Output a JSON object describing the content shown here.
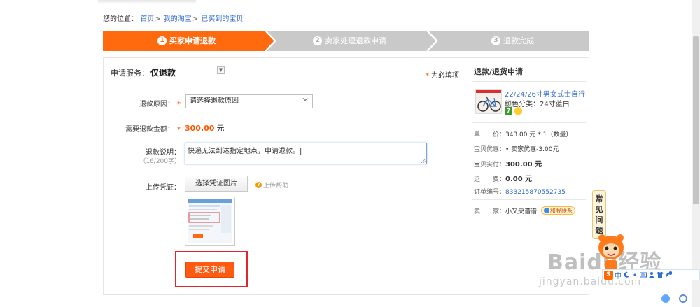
{
  "breadcrumb": {
    "prefix": "您的位置：",
    "items": [
      "首页",
      "我的淘宝",
      "已买到的宝贝"
    ],
    "separator": ">"
  },
  "steps": [
    {
      "num": "1",
      "label": "买家申请退款",
      "active": true
    },
    {
      "num": "2",
      "label": "卖家处理退款申请",
      "active": false
    },
    {
      "num": "3",
      "label": "退款完成",
      "active": false
    }
  ],
  "form": {
    "service_label": "申请服务：",
    "service_value": "仅退款",
    "required_note": "为必填项",
    "required_star": "*",
    "reason_label": "退款原因：",
    "reason_placeholder": "请选择退款原因",
    "amount_label": "需要退款金额：",
    "amount_value": "300.00",
    "amount_unit": "元",
    "desc_label": "退款说明：",
    "desc_count": "（16/200字）",
    "desc_value": "快递无法到达指定地点，申请退款。|",
    "upload_label": "上传凭证：",
    "upload_button": "选择凭证图片",
    "upload_help": "上传帮助",
    "submit_button": "提交申请"
  },
  "side": {
    "title": "退款/退货申请",
    "product_name": "22/24/26寸男女式士自行...",
    "product_attr": "颜色分类：24寸蓝白",
    "badge_7": "7",
    "price_label": "单　　价：",
    "price_value": "343.00 元 * 1（数量）",
    "discount_label": "宝贝优惠：",
    "discount_value": "• 卖家优惠-3.00元",
    "paid_label": "宝贝实付：",
    "paid_value": "300.00 元",
    "shipping_label": "运　　费：",
    "shipping_value": "0.00 元",
    "order_label": "订单编号：",
    "order_value": "833215870552735",
    "seller_label": "卖　　家：",
    "seller_value": "小又央谱谱",
    "contact": "和我联系"
  },
  "faq": [
    "常",
    "见",
    "问",
    "题"
  ],
  "watermark": {
    "main": "Baidu经验",
    "sub": "jingyan.baidu.com"
  },
  "ime": {
    "s": "S",
    "mode": "中"
  },
  "colors": {
    "accent": "#ff6a0f",
    "link": "#2e6bd1",
    "step_inactive": "#c9c9c9",
    "highlight_frame": "#e0262a"
  }
}
